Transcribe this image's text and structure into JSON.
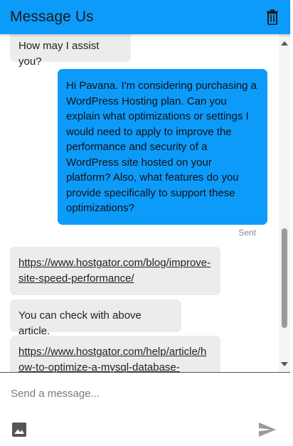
{
  "header": {
    "title": "Message Us",
    "delete_icon": "trash-icon"
  },
  "messages": [
    {
      "role": "agent",
      "text": "How may I assist you?"
    },
    {
      "role": "user",
      "text": "Hi Pavana. I'm considering purchasing a WordPress Hosting plan. Can you explain what optimizations or settings I would need to apply to improve the performance and security of a WordPress site hosted on your platform? Also, what features do you provide specifically to support these optimizations?",
      "status": "Sent"
    },
    {
      "role": "agent",
      "link": "https://www.hostgator.com/blog/improve-site-speed-performance/"
    },
    {
      "role": "agent",
      "text": "You can check with above article."
    },
    {
      "role": "agent",
      "link": "https://www.hostgator.com/help/article/how-to-optimize-a-mysql-database-"
    }
  ],
  "composer": {
    "placeholder": "Send a message...",
    "value": "",
    "image_icon": "image-icon",
    "send_icon": "send-icon"
  },
  "colors": {
    "header": "#0d9bfa",
    "user_bubble": "#0d9bfa",
    "agent_bubble": "#ececec"
  }
}
